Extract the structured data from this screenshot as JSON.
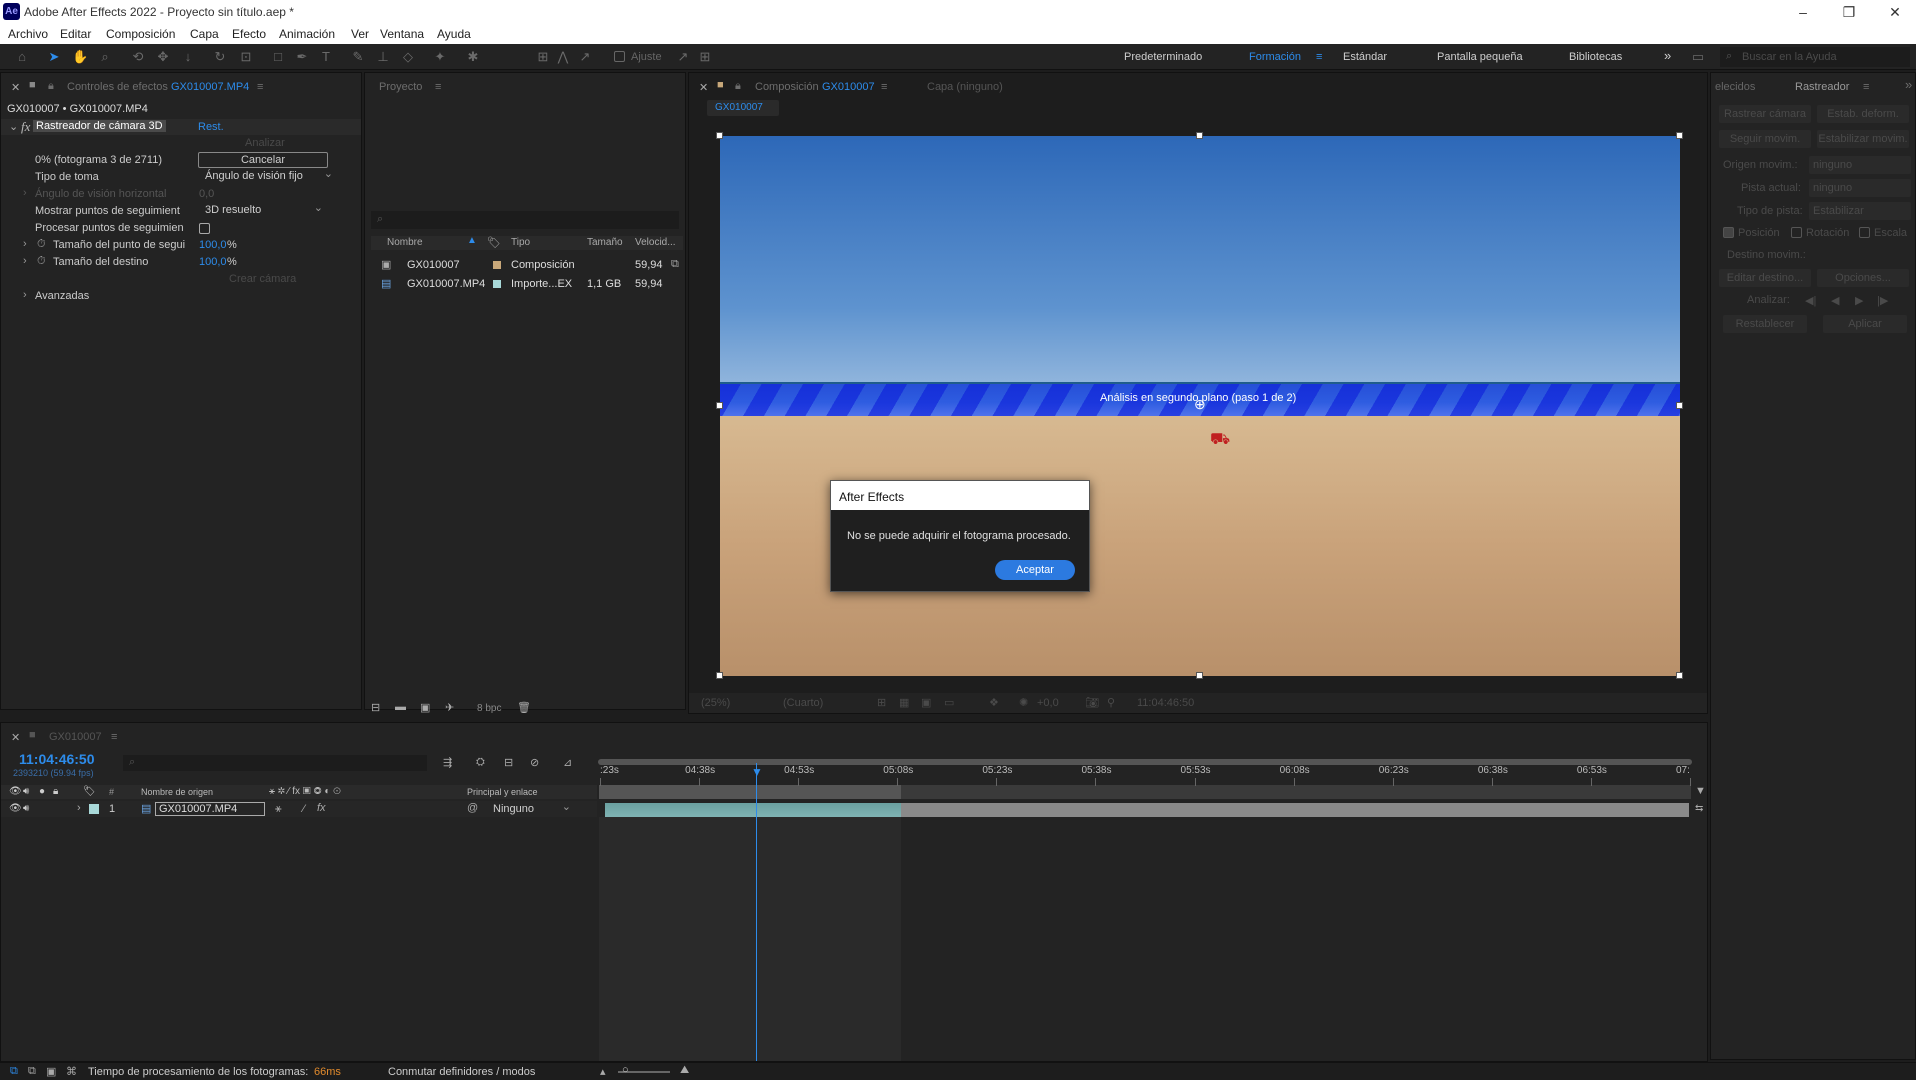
{
  "window": {
    "app_badge": "Ae",
    "title": "Adobe After Effects 2022 - Proyecto sin título.aep *"
  },
  "menu": [
    "Archivo",
    "Editar",
    "Composición",
    "Capa",
    "Efecto",
    "Animación",
    "Ver",
    "Ventana",
    "Ayuda"
  ],
  "toolbar": {
    "snap_label": "Ajuste",
    "search_placeholder": "Buscar en la Ayuda"
  },
  "workspaces": [
    "Predeterminado",
    "Formación",
    "Estándar",
    "Pantalla pequeña",
    "Bibliotecas"
  ],
  "workspace_active_color": "#2d8ceb",
  "effects": {
    "tab_prefix": "Controles de efectos",
    "tab_file": "GX010007.MP4",
    "breadcrumb": "GX010007 • GX010007.MP4",
    "effect_name": "Rastreador de cámara 3D",
    "reset": "Rest.",
    "analyze": "Analizar",
    "progress": "0% (fotograma 3 de 2711)",
    "cancel": "Cancelar",
    "shot_type_label": "Tipo de toma",
    "shot_type_value": "Ángulo de visión fijo",
    "fov_label": "Ángulo de visión horizontal",
    "fov_value": "0,0",
    "show_points_label": "Mostrar puntos de seguimient",
    "show_points_value": "3D resuelto",
    "render_points_label": "Procesar puntos de seguimien",
    "point_size_label": "Tamaño del punto de segui",
    "point_size_value": "100,0",
    "point_size_unit": "%",
    "target_size_label": "Tamaño del destino",
    "target_size_value": "100,0",
    "target_size_unit": "%",
    "create_camera": "Crear cámara",
    "advanced": "Avanzadas"
  },
  "project": {
    "tab": "Proyecto",
    "columns": [
      "Nombre",
      "Tipo",
      "Tamaño",
      "Velocid..."
    ],
    "items": [
      {
        "name": "GX010007",
        "type": "Composición",
        "size": "",
        "fps": "59,94"
      },
      {
        "name": "GX010007.MP4",
        "type": "Importe...EX",
        "size": "1,1 GB",
        "fps": "59,94"
      }
    ],
    "bpc": "8 bpc"
  },
  "composition": {
    "tab_prefix": "Composición",
    "tab_name": "GX010007",
    "layer_tab": "Capa (ninguno)",
    "flow_chip": "GX010007",
    "analysis_overlay": "Análisis en segundo plano (paso 1 de 2)",
    "zoom": "(25%)",
    "resolution": "(Cuarto)",
    "exposure": "+0,0",
    "timecode": "11:04:46:50"
  },
  "dialog": {
    "title": "After Effects",
    "message": "No se puede adquirir el fotograma procesado.",
    "ok": "Aceptar"
  },
  "tracker": {
    "tab_left": "elecidos",
    "tab": "Rastreador",
    "track_camera": "Rastrear cámara",
    "warp_stab": "Estab. deform.",
    "track_motion": "Seguir movim.",
    "stabilize_motion": "Estabilizar movim.",
    "motion_source_label": "Origen movim.:",
    "motion_source_value": "ninguno",
    "current_track_label": "Pista actual:",
    "current_track_value": "ninguno",
    "track_type_label": "Tipo de pista:",
    "track_type_value": "Estabilizar",
    "position": "Posición",
    "rotation": "Rotación",
    "scale": "Escala",
    "motion_target": "Destino movim.:",
    "edit_target": "Editar destino...",
    "options": "Opciones...",
    "analyze": "Analizar:",
    "reset": "Restablecer",
    "apply": "Aplicar"
  },
  "timeline": {
    "tab": "GX010007",
    "timecode": "11:04:46:50",
    "frames": "2393210 (59.94 fps)",
    "col_source": "Nombre de origen",
    "col_parent": "Principal y enlace",
    "layer": {
      "num": "1",
      "name": "GX010007.MP4",
      "parent": "Ninguno"
    },
    "ticks": [
      ":23s",
      "04:38s",
      "04:53s",
      "05:08s",
      "05:23s",
      "05:38s",
      "05:53s",
      "06:08s",
      "06:23s",
      "06:38s",
      "06:53s",
      "07:"
    ]
  },
  "status": {
    "render_label": "Tiempo de procesamiento de los fotogramas:",
    "render_value": "66ms",
    "toggle": "Conmutar definidores / modos"
  }
}
